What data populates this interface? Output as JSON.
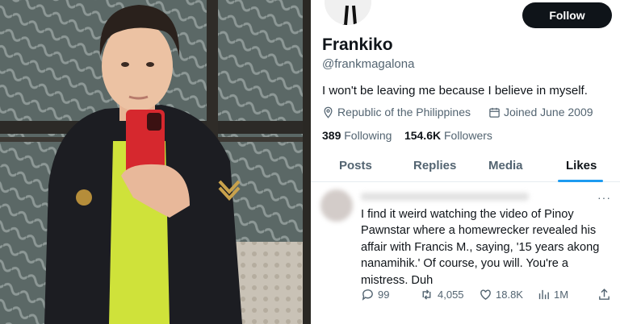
{
  "profile": {
    "follow_label": "Follow",
    "name": "Frankiko",
    "handle": "@frankmagalona",
    "bio": "I won't be leaving me because I believe in myself.",
    "location": "Republic of the Philippines",
    "joined": "Joined June 2009",
    "following_count": "389",
    "following_label": "Following",
    "followers_count": "154.6K",
    "followers_label": "Followers"
  },
  "tabs": [
    "Posts",
    "Replies",
    "Media",
    "Likes"
  ],
  "active_tab": "Likes",
  "tweet": {
    "text": "I find it weird watching the video of Pinoy Pawnstar where a homewrecker revealed his affair with Francis M., saying, '15 years akong nanamihik.' Of course, you will. You're a mistress. Duh",
    "replies": "99",
    "retweets": "4,055",
    "likes": "18.8K",
    "views": "1M"
  },
  "colors": {
    "accent": "#1d9bf0",
    "button": "#0f1419",
    "muted": "#536471",
    "shirt": "#cfe23a",
    "phone": "#d6282e"
  },
  "icons": [
    "location-icon",
    "calendar-icon",
    "reply-icon",
    "retweet-icon",
    "like-icon",
    "views-icon",
    "share-icon",
    "more-icon"
  ]
}
